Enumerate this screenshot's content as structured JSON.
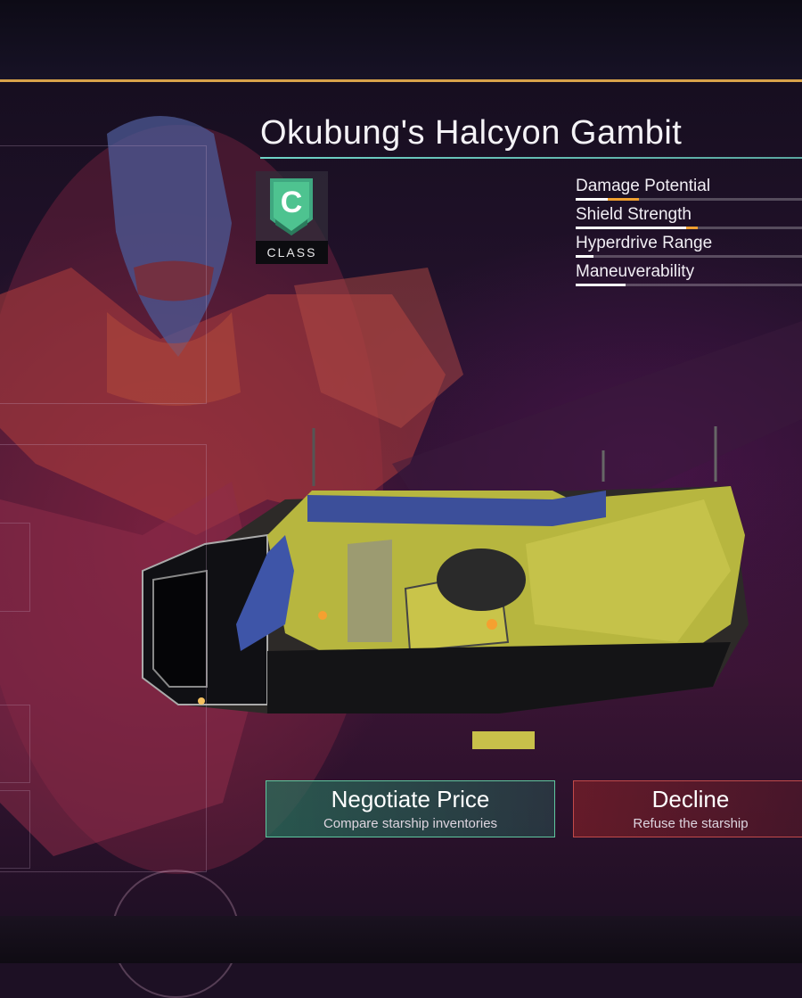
{
  "ship": {
    "name": "Okubung's Halcyon Gambit",
    "class_letter": "C",
    "class_label": "CLASS"
  },
  "stats": [
    {
      "label": "Damage Potential",
      "level": 0.14,
      "accent_level": 0.14
    },
    {
      "label": "Shield Strength",
      "level": 0.49,
      "accent_level": 0.05
    },
    {
      "label": "Hyperdrive Range",
      "level": 0.08,
      "accent_level": 0.0
    },
    {
      "label": "Maneuverability",
      "level": 0.22,
      "accent_level": 0.0
    }
  ],
  "actions": {
    "negotiate": {
      "title": "Negotiate Price",
      "subtitle": "Compare starship inventories"
    },
    "decline": {
      "title": "Decline",
      "subtitle": "Refuse the starship"
    }
  },
  "colors": {
    "accent_line": "#d8a24a",
    "title_rule": "#6fd3c7",
    "class_badge": "#3fa880",
    "negotiate_border": "#5fc79f",
    "decline_border": "#c24a4a",
    "stat_accent": "#f0a030"
  },
  "icons": {
    "class_badge": "class-c-chevron-icon"
  }
}
